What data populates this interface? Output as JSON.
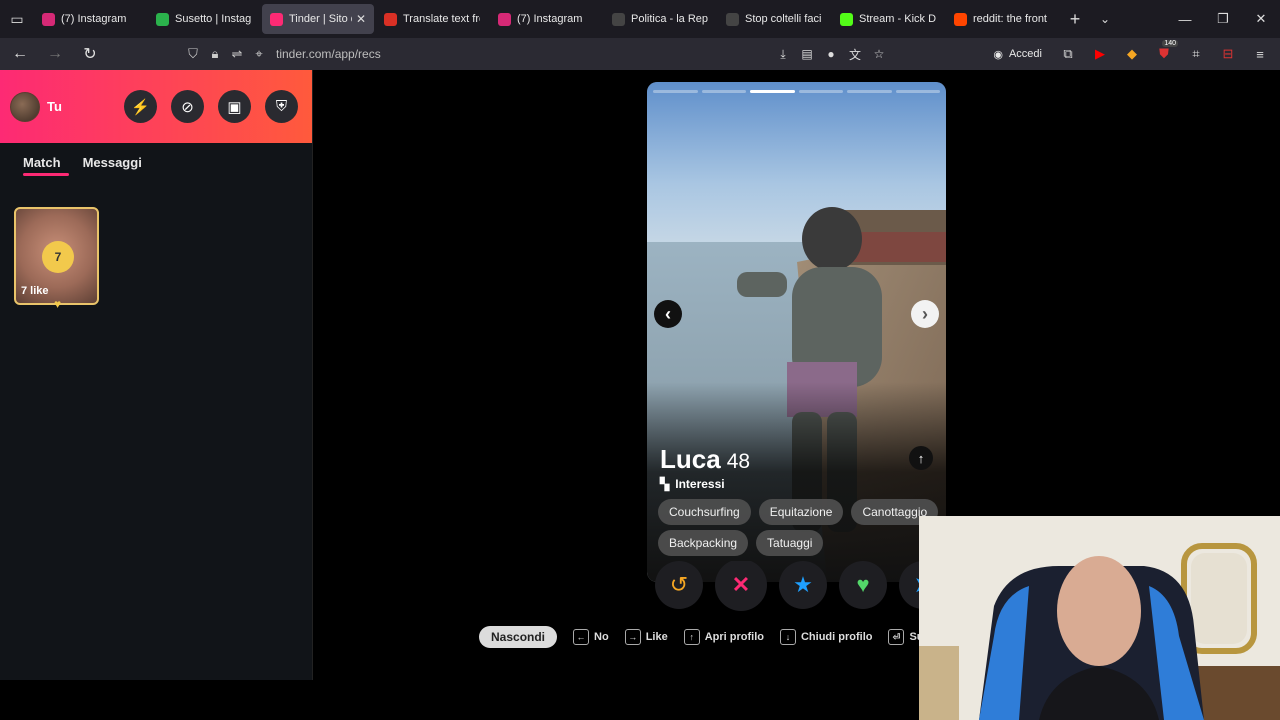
{
  "browser": {
    "tabs": [
      {
        "label": "(7) Instagram",
        "favicon": "instagram-icon",
        "color": "#d62976",
        "active": false
      },
      {
        "label": "Susetto | Instagram",
        "favicon": "app-icon",
        "color": "#2bb24c",
        "active": false
      },
      {
        "label": "Tinder | Sito di",
        "favicon": "tinder-icon",
        "color": "#fd2a74",
        "active": true
      },
      {
        "label": "Translate text from",
        "favicon": "translate-icon",
        "color": "#d93025",
        "active": false
      },
      {
        "label": "(7) Instagram",
        "favicon": "instagram-icon",
        "color": "#d62976",
        "active": false
      },
      {
        "label": "Politica - la Repubblica",
        "favicon": "repubblica-icon",
        "color": "#444444",
        "active": false
      },
      {
        "label": "Stop coltelli facili",
        "favicon": "repubblica-icon",
        "color": "#444444",
        "active": false
      },
      {
        "label": "Stream - Kick Dashboard",
        "favicon": "kick-icon",
        "color": "#53fc18",
        "active": false
      },
      {
        "label": "reddit: the front page",
        "favicon": "reddit-icon",
        "color": "#ff4500",
        "active": false
      }
    ],
    "url": "tinder.com/app/recs",
    "signin_label": "Accedi",
    "ext_badge": "140"
  },
  "sidebar": {
    "user_name": "Tu",
    "tabs": [
      {
        "label": "Match",
        "active": true
      },
      {
        "label": "Messaggi",
        "active": false
      }
    ],
    "likes_count": "7",
    "likes_label": "7 like"
  },
  "profile": {
    "name": "Luca",
    "age": "48",
    "interests_title": "Interessi",
    "interests": [
      "Couchsurfing",
      "Equitazione",
      "Canottaggio",
      "Backpacking",
      "Tatuaggi"
    ],
    "photo_count": 6,
    "current_photo": 3
  },
  "shortcuts": {
    "hide_label": "Nascondi",
    "items": [
      {
        "key": "←",
        "label": "No"
      },
      {
        "key": "→",
        "label": "Like"
      },
      {
        "key": "↑",
        "label": "Apri profilo"
      },
      {
        "key": "↓",
        "label": "Chiudi profilo"
      },
      {
        "key": "⏎",
        "label": "Super Like"
      }
    ]
  },
  "colors": {
    "brand_start": "#fd2a74",
    "brand_end": "#ff5a3c",
    "nope": "#fd2a74",
    "like": "#53d769",
    "superlike": "#1ea0ff",
    "rewind": "#f5a623",
    "gold": "#f2c94c"
  }
}
